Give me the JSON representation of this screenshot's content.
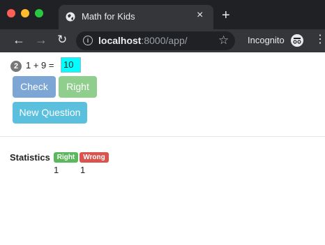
{
  "browser": {
    "tab_title": "Math for Kids",
    "tab_close": "×",
    "new_tab": "+",
    "url_host": "localhost",
    "url_rest": ":8000/app/",
    "incognito_label": "Incognito",
    "icons": [
      "globe-icon",
      "close-icon",
      "plus-icon",
      "back-arrow-icon",
      "forward-arrow-icon",
      "reload-icon",
      "info-icon",
      "star-icon",
      "incognito-icon",
      "menu-dots-icon"
    ]
  },
  "question": {
    "number": "2",
    "text": "1 + 9 =",
    "answer_value": "10",
    "answer_bg_color": "#00ffff"
  },
  "buttons": {
    "check_label": "Check",
    "right_label": "Right",
    "new_question_label": "New Question"
  },
  "statistics": {
    "label": "Statistics",
    "right_label": "Right",
    "wrong_label": "Wrong",
    "right_count": "1",
    "wrong_count": "1",
    "right_color": "#5cb85c",
    "wrong_color": "#d9534f"
  }
}
